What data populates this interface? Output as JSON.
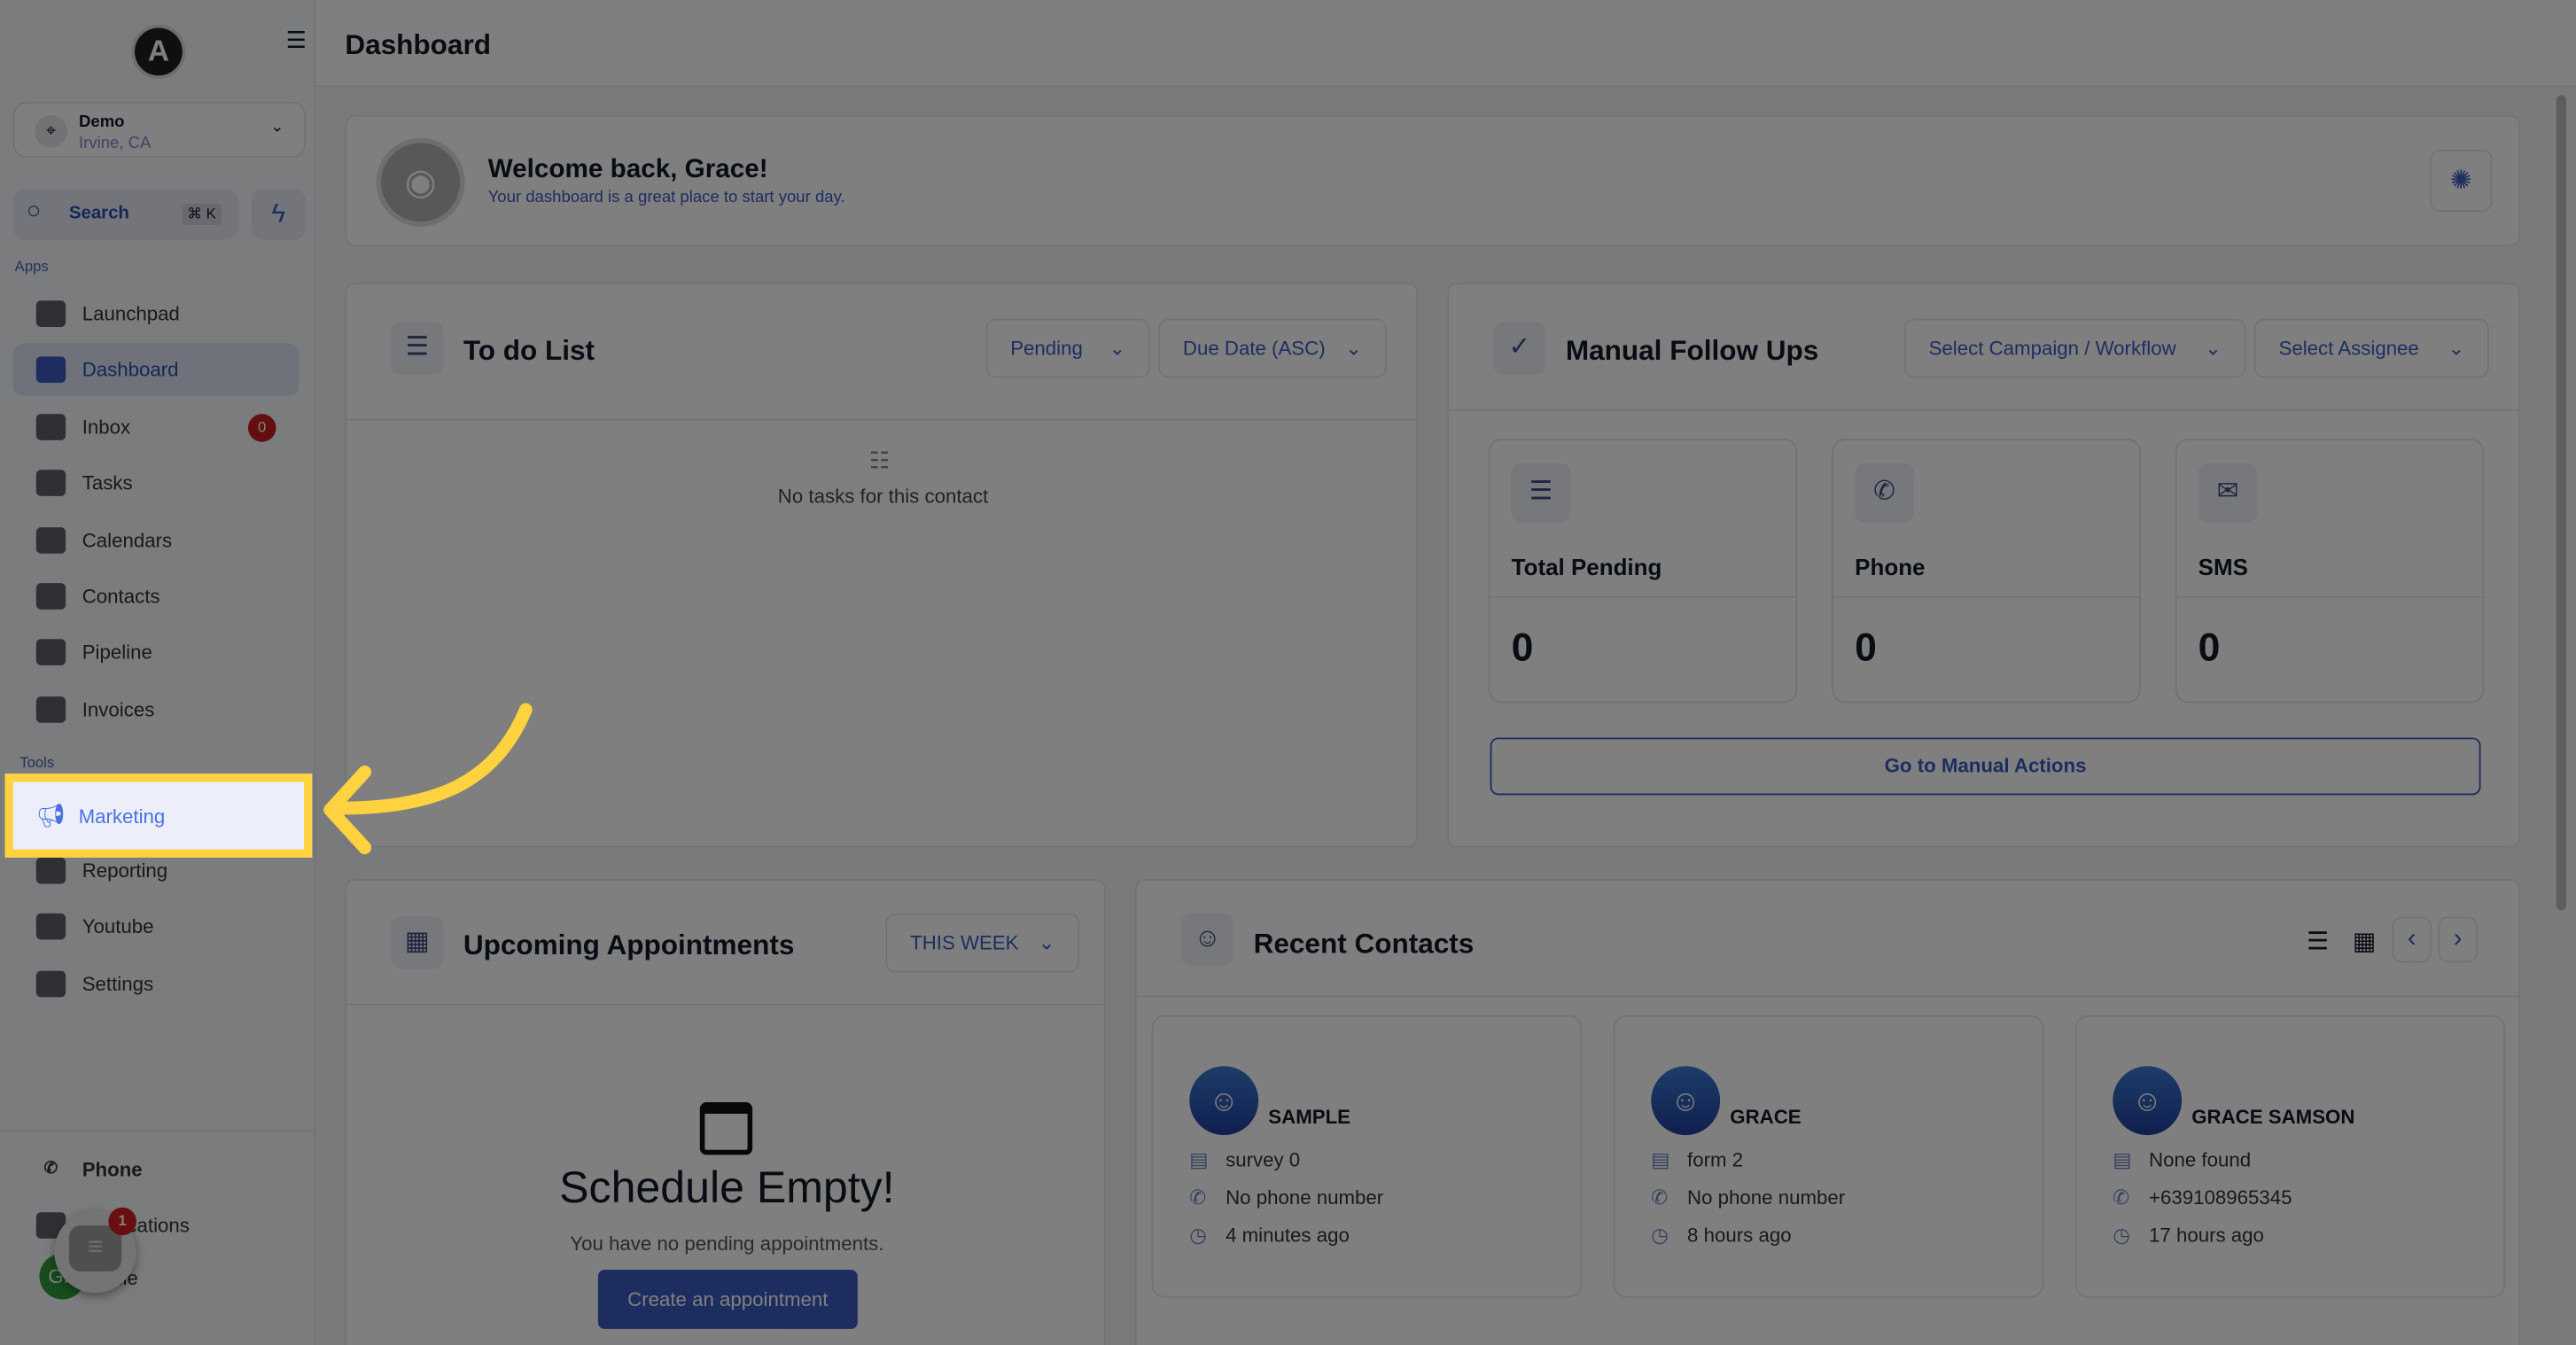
{
  "header": {
    "title": "Dashboard"
  },
  "sidebar": {
    "logo": "A",
    "location": {
      "name": "Demo",
      "city": "Irvine, CA"
    },
    "search": {
      "label": "Search",
      "shortcut": "⌘ K"
    },
    "apps_label": "Apps",
    "tools_label": "Tools",
    "apps": [
      {
        "label": "Launchpad",
        "icon": "rocket-icon"
      },
      {
        "label": "Dashboard",
        "icon": "dashboard-icon",
        "active": true
      },
      {
        "label": "Inbox",
        "icon": "inbox-icon",
        "badge": "0"
      },
      {
        "label": "Tasks",
        "icon": "tasks-icon"
      },
      {
        "label": "Calendars",
        "icon": "calendar-icon"
      },
      {
        "label": "Contacts",
        "icon": "contacts-icon"
      },
      {
        "label": "Pipeline",
        "icon": "pipeline-icon"
      },
      {
        "label": "Invoices",
        "icon": "invoice-icon"
      }
    ],
    "tools": [
      {
        "label": "Marketing",
        "icon": "megaphone-icon",
        "highlighted": true
      },
      {
        "label": "Reporting",
        "icon": "chart-icon"
      },
      {
        "label": "Youtube",
        "icon": "youtube-icon"
      },
      {
        "label": "Settings",
        "icon": "gear-icon"
      }
    ],
    "bottom": [
      {
        "label": "Phone"
      },
      {
        "label": "Notifications"
      },
      {
        "label": "Profile"
      }
    ],
    "avatar": "GP",
    "chat_badge": "1"
  },
  "welcome": {
    "title": "Welcome back, Grace!",
    "subtitle": "Your dashboard is a great place to start your day."
  },
  "todo": {
    "title": "To do List",
    "filter": "Pending",
    "sort": "Due Date (ASC)",
    "empty": "No tasks for this contact"
  },
  "followups": {
    "title": "Manual Follow Ups",
    "campaign": "Select Campaign / Workflow",
    "assignee": "Select Assignee",
    "stats": [
      {
        "label": "Total Pending",
        "value": "0"
      },
      {
        "label": "Phone",
        "value": "0"
      },
      {
        "label": "SMS",
        "value": "0"
      }
    ],
    "action": "Go to Manual Actions"
  },
  "appointments": {
    "title": "Upcoming Appointments",
    "range": "THIS WEEK",
    "empty_title": "Schedule Empty!",
    "empty_text": "You have no pending appointments.",
    "create": "Create an appointment"
  },
  "contacts": {
    "title": "Recent Contacts",
    "items": [
      {
        "name": "SAMPLE",
        "source": "survey 0",
        "phone": "No phone number",
        "time": "4 minutes ago"
      },
      {
        "name": "GRACE",
        "source": "form 2",
        "phone": "No phone number",
        "time": "8 hours ago"
      },
      {
        "name": "GRACE SAMSON",
        "source": "None found",
        "phone": "+639108965345",
        "time": "17 hours ago"
      }
    ]
  },
  "colors": {
    "accent": "#3b5bc0",
    "highlight": "#ffd23f"
  }
}
